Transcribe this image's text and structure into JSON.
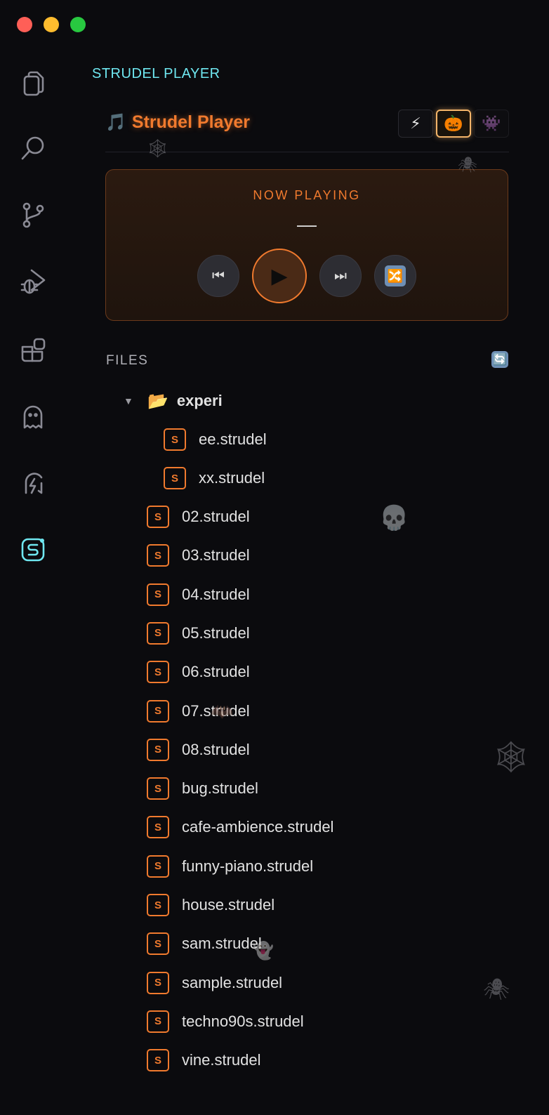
{
  "window": {
    "controls": [
      "close",
      "minimize",
      "zoom"
    ]
  },
  "activity_bar": {
    "items": [
      {
        "icon": "files-icon"
      },
      {
        "icon": "search-icon"
      },
      {
        "icon": "source-control-icon"
      },
      {
        "icon": "run-debug-icon"
      },
      {
        "icon": "extensions-icon"
      },
      {
        "icon": "ghost-icon"
      },
      {
        "icon": "bolt-ghost-icon"
      },
      {
        "icon": "strudel-icon",
        "active": true
      }
    ]
  },
  "sidebar": {
    "title": "STRUDEL PLAYER"
  },
  "header": {
    "note_glyph": "🎵",
    "title": "Strudel Player",
    "themes": [
      {
        "icon": "lightning-icon",
        "glyph": "⚡"
      },
      {
        "icon": "pumpkin-icon",
        "glyph": "🎃",
        "active": true
      },
      {
        "icon": "spider-witch-icon",
        "glyph": "👾"
      }
    ]
  },
  "player": {
    "label": "NOW PLAYING",
    "track": "—",
    "controls": {
      "prev": "⏮",
      "play": "▶",
      "next": "⏭",
      "shuffle": "🔀"
    }
  },
  "files": {
    "label": "FILES",
    "refresh_glyph": "🔄",
    "folder": {
      "name": "experi",
      "expanded": true,
      "children": [
        "ee.strudel",
        "xx.strudel"
      ]
    },
    "items": [
      "02.strudel",
      "03.strudel",
      "04.strudel",
      "05.strudel",
      "06.strudel",
      "07.strudel",
      "08.strudel",
      "bug.strudel",
      "cafe-ambience.strudel",
      "funny-piano.strudel",
      "house.strudel",
      "sam.strudel",
      "sample.strudel",
      "techno90s.strudel",
      "vine.strudel"
    ],
    "file_badge": "S"
  },
  "colors": {
    "accent": "#f07a2e",
    "cyan": "#6fe7f0",
    "background": "#0b0b0e"
  }
}
